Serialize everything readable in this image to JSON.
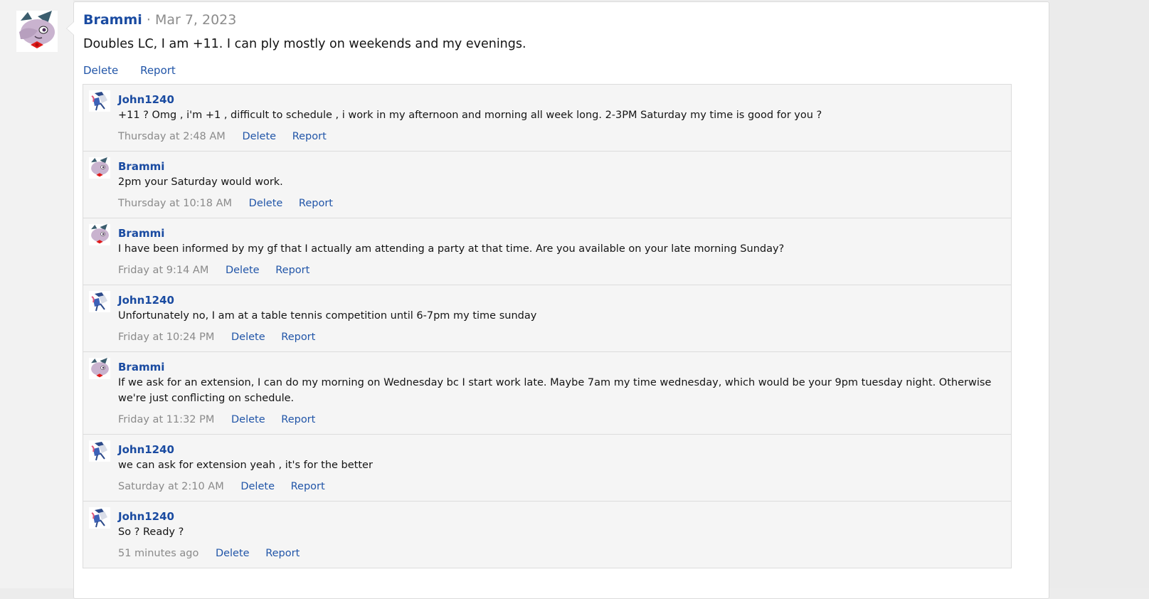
{
  "post": {
    "author": "Brammi",
    "separator": "·",
    "date": "Mar 7, 2023",
    "body": "Doubles LC, I am +11. I can ply mostly on weekends and my evenings.",
    "delete_label": "Delete",
    "report_label": "Report"
  },
  "comments": [
    {
      "author": "John1240",
      "text": "+11 ? Omg , i'm +1 , difficult to schedule , i work in my afternoon and morning all week long. 2-3PM Saturday my time is good for you ?",
      "time": "Thursday at 2:48 AM",
      "delete_label": "Delete",
      "report_label": "Report"
    },
    {
      "author": "Brammi",
      "text": "2pm your Saturday would work.",
      "time": "Thursday at 10:18 AM",
      "delete_label": "Delete",
      "report_label": "Report"
    },
    {
      "author": "Brammi",
      "text": "I have been informed by my gf that I actually am attending a party at that time. Are you available on your late morning Sunday?",
      "time": "Friday at 9:14 AM",
      "delete_label": "Delete",
      "report_label": "Report"
    },
    {
      "author": "John1240",
      "text": "Unfortunately no, I am at a table tennis competition until 6-7pm my time sunday",
      "time": "Friday at 10:24 PM",
      "delete_label": "Delete",
      "report_label": "Report"
    },
    {
      "author": "Brammi",
      "text": "If we ask for an extension, I can do my morning on Wednesday bc I start work late. Maybe 7am my time wednesday, which would be your 9pm tuesday night. Otherwise we're just conflicting on schedule.",
      "time": "Friday at 11:32 PM",
      "delete_label": "Delete",
      "report_label": "Report"
    },
    {
      "author": "John1240",
      "text": "we can ask for extension yeah , it's for the better",
      "time": "Saturday at 2:10 AM",
      "delete_label": "Delete",
      "report_label": "Report"
    },
    {
      "author": "John1240",
      "text": "So ? Ready ?",
      "time": "51 minutes ago",
      "delete_label": "Delete",
      "report_label": "Report"
    }
  ],
  "colors": {
    "link": "#2155a8",
    "author": "#1a4ba1",
    "muted": "#8a8a8a",
    "comment_bg": "#f5f5f5"
  },
  "icons": {
    "brammi_avatar": "pony-avatar-icon",
    "john_avatar": "pony-runner-avatar-icon"
  }
}
